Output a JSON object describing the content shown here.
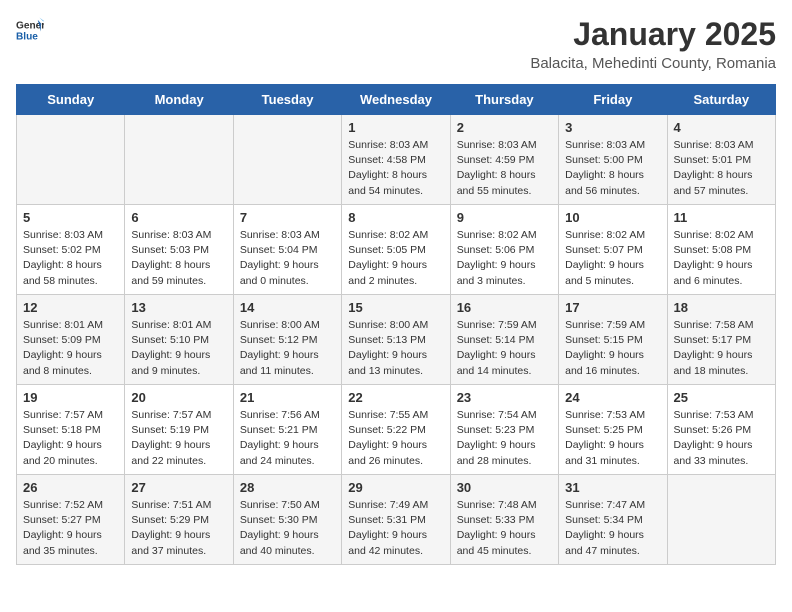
{
  "logo": {
    "general": "General",
    "blue": "Blue"
  },
  "title": "January 2025",
  "subtitle": "Balacita, Mehedinti County, Romania",
  "days_of_week": [
    "Sunday",
    "Monday",
    "Tuesday",
    "Wednesday",
    "Thursday",
    "Friday",
    "Saturday"
  ],
  "weeks": [
    [
      {
        "day": "",
        "info": ""
      },
      {
        "day": "",
        "info": ""
      },
      {
        "day": "",
        "info": ""
      },
      {
        "day": "1",
        "info": "Sunrise: 8:03 AM\nSunset: 4:58 PM\nDaylight: 8 hours\nand 54 minutes."
      },
      {
        "day": "2",
        "info": "Sunrise: 8:03 AM\nSunset: 4:59 PM\nDaylight: 8 hours\nand 55 minutes."
      },
      {
        "day": "3",
        "info": "Sunrise: 8:03 AM\nSunset: 5:00 PM\nDaylight: 8 hours\nand 56 minutes."
      },
      {
        "day": "4",
        "info": "Sunrise: 8:03 AM\nSunset: 5:01 PM\nDaylight: 8 hours\nand 57 minutes."
      }
    ],
    [
      {
        "day": "5",
        "info": "Sunrise: 8:03 AM\nSunset: 5:02 PM\nDaylight: 8 hours\nand 58 minutes."
      },
      {
        "day": "6",
        "info": "Sunrise: 8:03 AM\nSunset: 5:03 PM\nDaylight: 8 hours\nand 59 minutes."
      },
      {
        "day": "7",
        "info": "Sunrise: 8:03 AM\nSunset: 5:04 PM\nDaylight: 9 hours\nand 0 minutes."
      },
      {
        "day": "8",
        "info": "Sunrise: 8:02 AM\nSunset: 5:05 PM\nDaylight: 9 hours\nand 2 minutes."
      },
      {
        "day": "9",
        "info": "Sunrise: 8:02 AM\nSunset: 5:06 PM\nDaylight: 9 hours\nand 3 minutes."
      },
      {
        "day": "10",
        "info": "Sunrise: 8:02 AM\nSunset: 5:07 PM\nDaylight: 9 hours\nand 5 minutes."
      },
      {
        "day": "11",
        "info": "Sunrise: 8:02 AM\nSunset: 5:08 PM\nDaylight: 9 hours\nand 6 minutes."
      }
    ],
    [
      {
        "day": "12",
        "info": "Sunrise: 8:01 AM\nSunset: 5:09 PM\nDaylight: 9 hours\nand 8 minutes."
      },
      {
        "day": "13",
        "info": "Sunrise: 8:01 AM\nSunset: 5:10 PM\nDaylight: 9 hours\nand 9 minutes."
      },
      {
        "day": "14",
        "info": "Sunrise: 8:00 AM\nSunset: 5:12 PM\nDaylight: 9 hours\nand 11 minutes."
      },
      {
        "day": "15",
        "info": "Sunrise: 8:00 AM\nSunset: 5:13 PM\nDaylight: 9 hours\nand 13 minutes."
      },
      {
        "day": "16",
        "info": "Sunrise: 7:59 AM\nSunset: 5:14 PM\nDaylight: 9 hours\nand 14 minutes."
      },
      {
        "day": "17",
        "info": "Sunrise: 7:59 AM\nSunset: 5:15 PM\nDaylight: 9 hours\nand 16 minutes."
      },
      {
        "day": "18",
        "info": "Sunrise: 7:58 AM\nSunset: 5:17 PM\nDaylight: 9 hours\nand 18 minutes."
      }
    ],
    [
      {
        "day": "19",
        "info": "Sunrise: 7:57 AM\nSunset: 5:18 PM\nDaylight: 9 hours\nand 20 minutes."
      },
      {
        "day": "20",
        "info": "Sunrise: 7:57 AM\nSunset: 5:19 PM\nDaylight: 9 hours\nand 22 minutes."
      },
      {
        "day": "21",
        "info": "Sunrise: 7:56 AM\nSunset: 5:21 PM\nDaylight: 9 hours\nand 24 minutes."
      },
      {
        "day": "22",
        "info": "Sunrise: 7:55 AM\nSunset: 5:22 PM\nDaylight: 9 hours\nand 26 minutes."
      },
      {
        "day": "23",
        "info": "Sunrise: 7:54 AM\nSunset: 5:23 PM\nDaylight: 9 hours\nand 28 minutes."
      },
      {
        "day": "24",
        "info": "Sunrise: 7:53 AM\nSunset: 5:25 PM\nDaylight: 9 hours\nand 31 minutes."
      },
      {
        "day": "25",
        "info": "Sunrise: 7:53 AM\nSunset: 5:26 PM\nDaylight: 9 hours\nand 33 minutes."
      }
    ],
    [
      {
        "day": "26",
        "info": "Sunrise: 7:52 AM\nSunset: 5:27 PM\nDaylight: 9 hours\nand 35 minutes."
      },
      {
        "day": "27",
        "info": "Sunrise: 7:51 AM\nSunset: 5:29 PM\nDaylight: 9 hours\nand 37 minutes."
      },
      {
        "day": "28",
        "info": "Sunrise: 7:50 AM\nSunset: 5:30 PM\nDaylight: 9 hours\nand 40 minutes."
      },
      {
        "day": "29",
        "info": "Sunrise: 7:49 AM\nSunset: 5:31 PM\nDaylight: 9 hours\nand 42 minutes."
      },
      {
        "day": "30",
        "info": "Sunrise: 7:48 AM\nSunset: 5:33 PM\nDaylight: 9 hours\nand 45 minutes."
      },
      {
        "day": "31",
        "info": "Sunrise: 7:47 AM\nSunset: 5:34 PM\nDaylight: 9 hours\nand 47 minutes."
      },
      {
        "day": "",
        "info": ""
      }
    ]
  ]
}
